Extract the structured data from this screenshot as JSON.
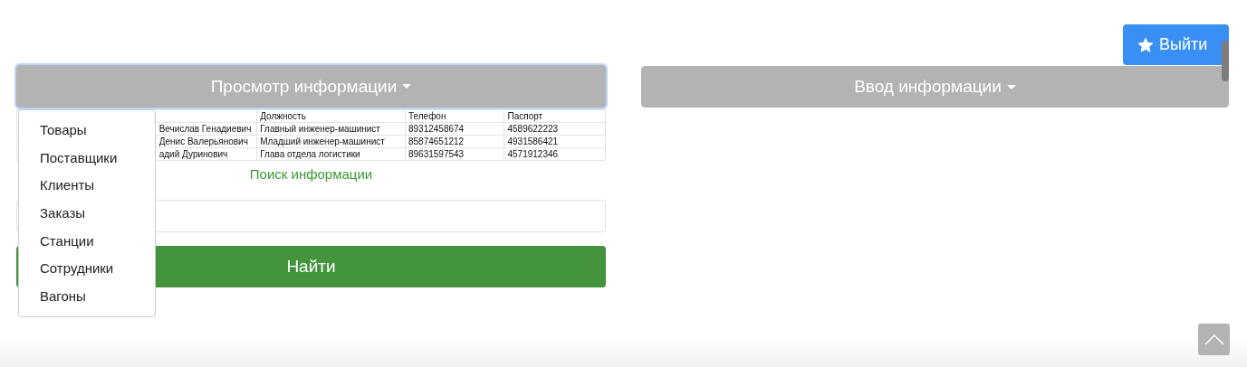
{
  "logout_button": {
    "label": "Выйти"
  },
  "view_menu": {
    "label": "Просмотр информации",
    "expanded": true,
    "items": [
      {
        "label": "Товары"
      },
      {
        "label": "Поставщики"
      },
      {
        "label": "Клиенты"
      },
      {
        "label": "Заказы"
      },
      {
        "label": "Станции"
      },
      {
        "label": "Сотрудники"
      },
      {
        "label": "Вагоны"
      }
    ]
  },
  "input_menu": {
    "label": "Ввод информации",
    "expanded": false
  },
  "table": {
    "headers": [
      "Должность",
      "Телефон",
      "Паспорт"
    ],
    "rows": [
      {
        "column_1": "Вечислав Генадиевич",
        "cells": [
          "Главный инженер-машинист",
          "89312458674",
          "4589622223"
        ]
      },
      {
        "column_1": "Денис Валерьянович",
        "cells": [
          "Младший инженер-машинист",
          "85874651212",
          "4931586421"
        ]
      },
      {
        "column_1": "адий Дуринович",
        "cells": [
          "Глава отдела логистики",
          "89631597543",
          "4571912346"
        ]
      }
    ]
  },
  "search": {
    "title": "Поиск информации",
    "button": "Найти"
  }
}
